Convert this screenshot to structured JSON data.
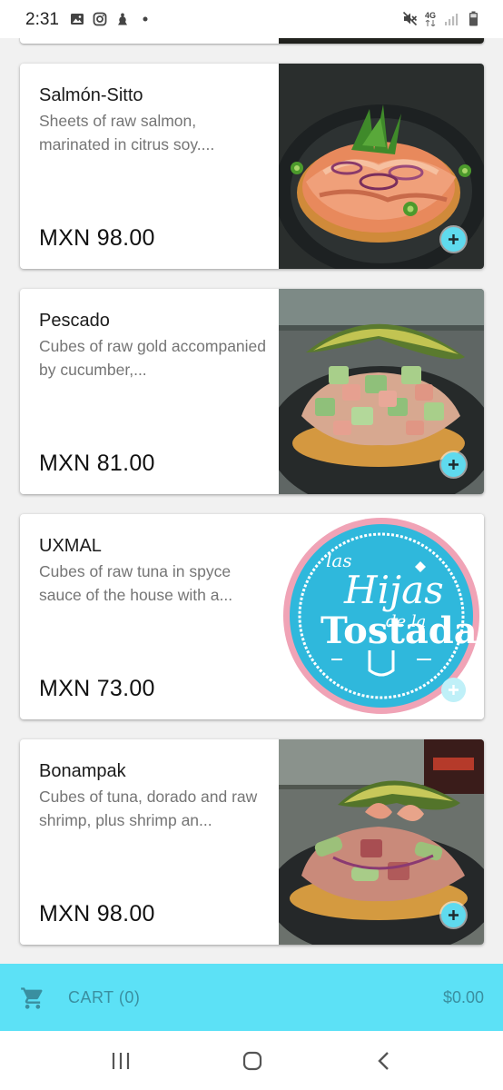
{
  "status_bar": {
    "time": "2:31",
    "network_label": "4G",
    "icons": [
      "gallery-icon",
      "instagram-icon",
      "app-notification-icon",
      "dot-icon",
      "mute-icon",
      "signal-icon",
      "battery-icon"
    ]
  },
  "products": [
    {
      "name": "Salmón-Sitto",
      "description": "Sheets of raw salmon, marinated in citrus soy....",
      "price": "MXN 98.00",
      "image": "salmon-tostada-photo"
    },
    {
      "name": "Pescado",
      "description": "Cubes of raw gold accompanied by cucumber,...",
      "price": "MXN 81.00",
      "image": "fish-tostada-photo"
    },
    {
      "name": "UXMAL",
      "description": "Cubes of raw tuna in spyce sauce of the house with a...",
      "price": "MXN 73.00",
      "image": "las-hijas-de-la-tostada-logo",
      "logo_text": [
        "las",
        "Hijas",
        "de la",
        "Tostada"
      ]
    },
    {
      "name": "Bonampak",
      "description": "Cubes of tuna, dorado and raw shrimp, plus shrimp an...",
      "price": "MXN 98.00",
      "image": "tuna-shrimp-tostada-photo"
    }
  ],
  "cart": {
    "label": "CART (0)",
    "total": "$0.00",
    "icon": "cart-icon"
  },
  "colors": {
    "accent": "#5ce1f6",
    "cart_text": "#3a8fa0",
    "add_button": "#5fdaee",
    "logo_blue": "#2fb8dc",
    "logo_pink": "#f0a3b6"
  },
  "navigation": [
    "recents-icon",
    "home-icon",
    "back-icon"
  ]
}
